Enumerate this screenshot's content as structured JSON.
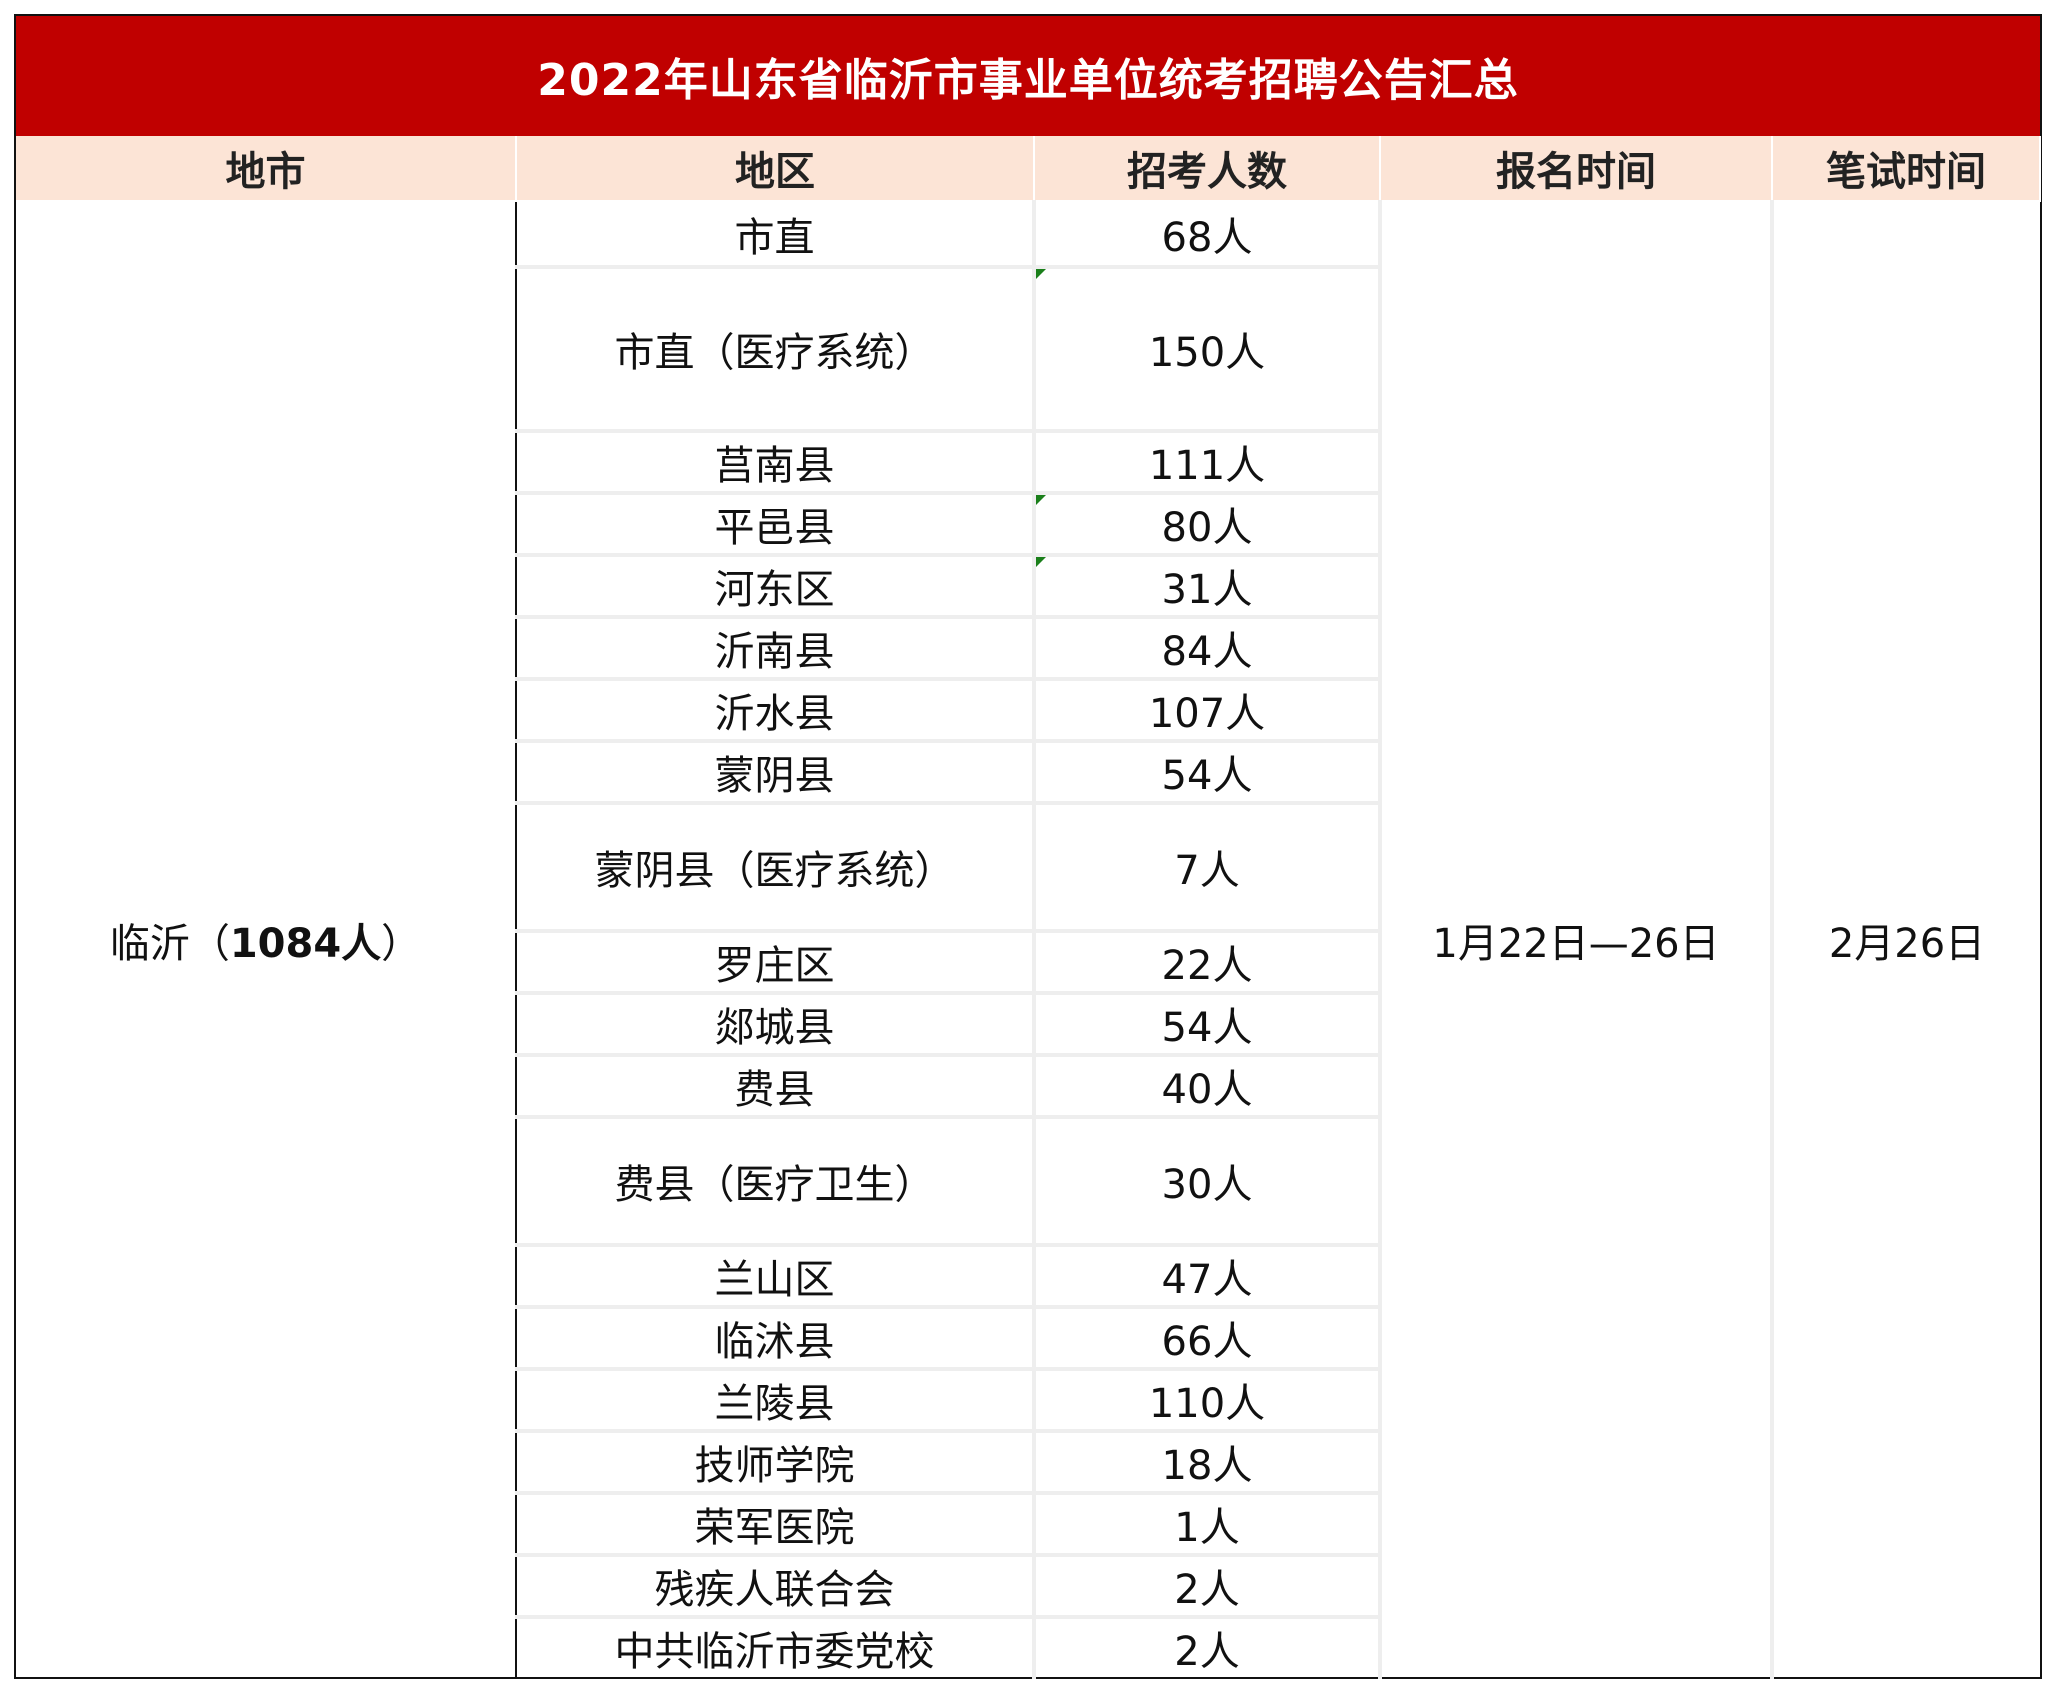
{
  "title": "2022年山东省临沂市事业单位统考招聘公告汇总",
  "headers": {
    "city": "地市",
    "region": "地区",
    "count": "招考人数",
    "registration": "报名时间",
    "exam": "笔试时间"
  },
  "city": {
    "name": "临沂（",
    "total": "1084人",
    "close": "）"
  },
  "registration_time": "1月22日—26日",
  "exam_time": "2月26日",
  "rows": [
    {
      "region": "市直",
      "count": "68人"
    },
    {
      "region": "市直（医疗系统）",
      "count": "150人"
    },
    {
      "region": "莒南县",
      "count": "111人"
    },
    {
      "region": "平邑县",
      "count": "80人"
    },
    {
      "region": "河东区",
      "count": "31人"
    },
    {
      "region": "沂南县",
      "count": "84人"
    },
    {
      "region": "沂水县",
      "count": "107人"
    },
    {
      "region": "蒙阴县",
      "count": "54人"
    },
    {
      "region": "蒙阴县（医疗系统）",
      "count": "7人"
    },
    {
      "region": "罗庄区",
      "count": "22人"
    },
    {
      "region": "郯城县",
      "count": "54人"
    },
    {
      "region": "费县",
      "count": "40人"
    },
    {
      "region": "费县（医疗卫生）",
      "count": "30人"
    },
    {
      "region": "兰山区",
      "count": "47人"
    },
    {
      "region": "临沭县",
      "count": "66人"
    },
    {
      "region": "兰陵县",
      "count": "110人"
    },
    {
      "region": "技师学院",
      "count": "18人"
    },
    {
      "region": "荣军医院",
      "count": "1人"
    },
    {
      "region": "残疾人联合会",
      "count": "2人"
    },
    {
      "region": "中共临沂市委党校",
      "count": "2人"
    }
  ]
}
